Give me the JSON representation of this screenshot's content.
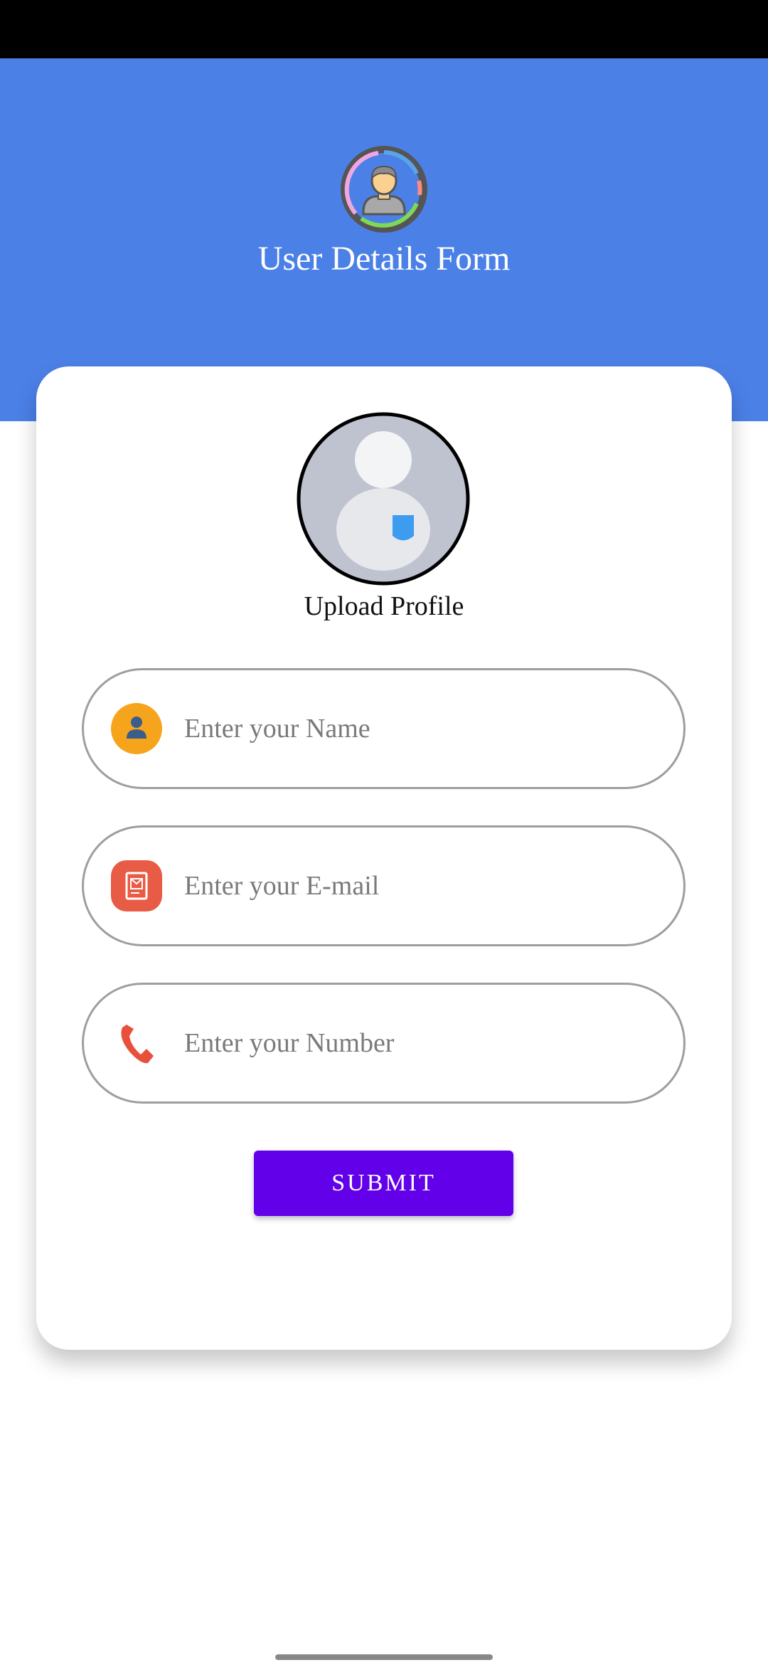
{
  "header": {
    "title": "User Details Form",
    "background_color": "#4b80e7",
    "logo_icon": "user-circle-logo-icon"
  },
  "profile": {
    "upload_label": "Upload Profile",
    "avatar_icon": "avatar-placeholder-icon"
  },
  "form": {
    "name": {
      "placeholder": "Enter your Name",
      "value": "",
      "icon": "person-icon"
    },
    "email": {
      "placeholder": "Enter your E-mail",
      "value": "",
      "icon": "email-icon"
    },
    "number": {
      "placeholder": "Enter your Number",
      "value": "",
      "icon": "phone-icon"
    },
    "submit_label": "SUBMIT",
    "submit_color": "#6200ea"
  }
}
